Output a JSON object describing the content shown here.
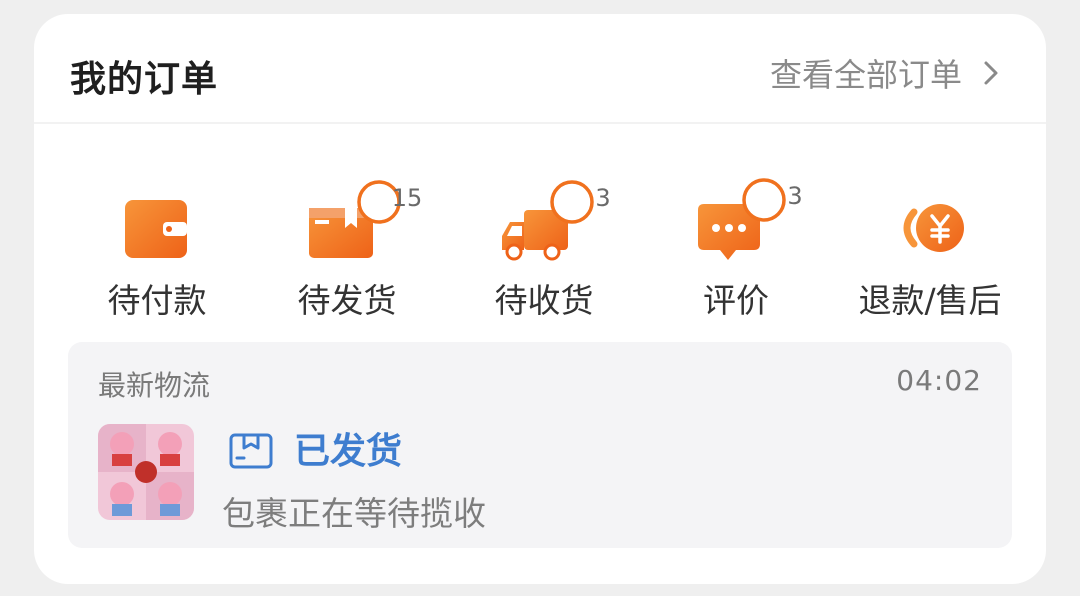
{
  "header": {
    "title": "我的订单",
    "view_all_label": "查看全部订单"
  },
  "order_status": [
    {
      "label": "待付款",
      "icon": "wallet-icon",
      "badge": ""
    },
    {
      "label": "待发货",
      "icon": "package-icon",
      "badge": "15"
    },
    {
      "label": "待收货",
      "icon": "truck-icon",
      "badge": "3"
    },
    {
      "label": "评价",
      "icon": "comment-icon",
      "badge": "3"
    },
    {
      "label": "退款/售后",
      "icon": "refund-icon",
      "badge": ""
    }
  ],
  "logistics": {
    "title": "最新物流",
    "time": "04:02",
    "status": "已发货",
    "detail": "包裹正在等待揽收",
    "status_icon": "shipped-box-icon"
  },
  "colors": {
    "accent_orange": "#f0711e",
    "accent_blue": "#3e7dcf",
    "badge_border": "#f0711e"
  }
}
